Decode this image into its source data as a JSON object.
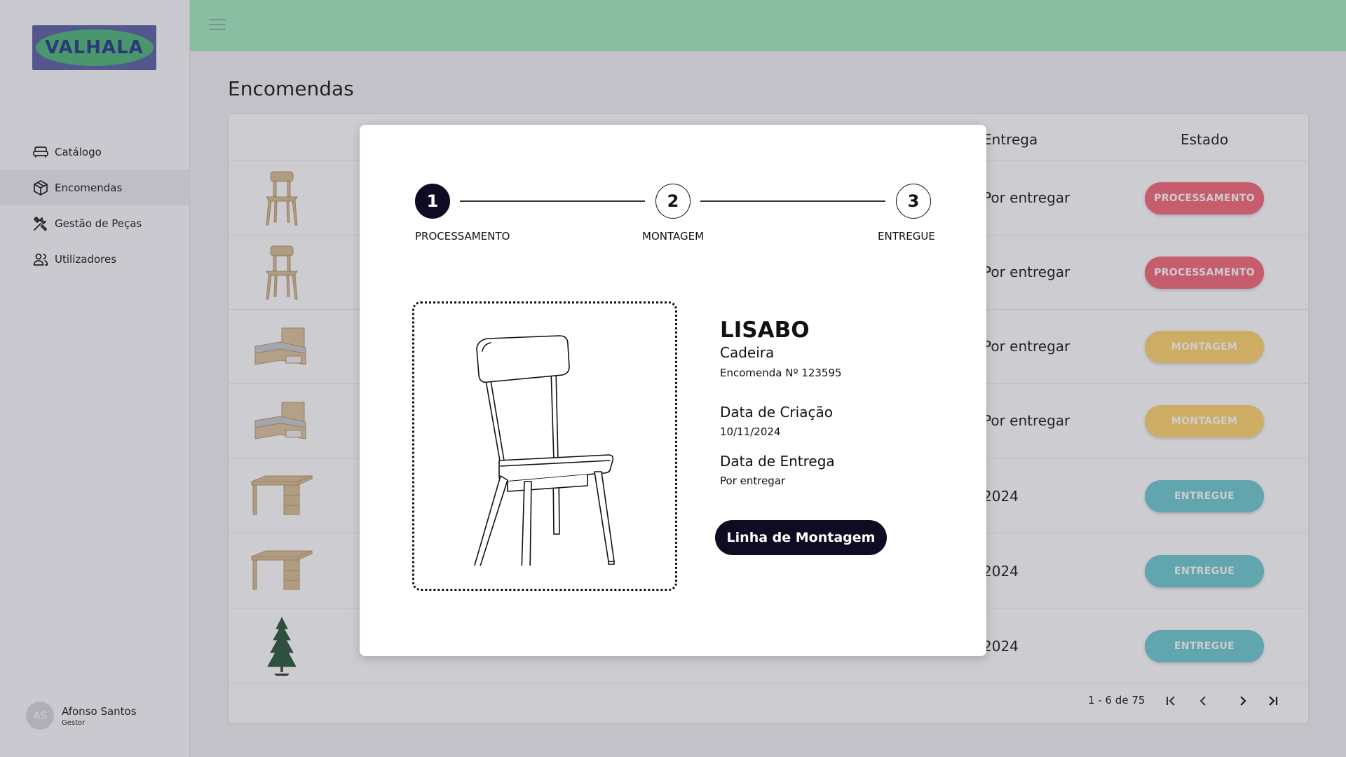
{
  "brand": {
    "logo_text": "VALHALA"
  },
  "sidebar": {
    "items": [
      {
        "label": "Catálogo",
        "icon": "sofa-icon"
      },
      {
        "label": "Encomendas",
        "icon": "package-icon",
        "active": true
      },
      {
        "label": "Gestão de Peças",
        "icon": "tools-icon"
      },
      {
        "label": "Utilizadores",
        "icon": "users-icon"
      }
    ],
    "user": {
      "initials": "AS",
      "name": "Afonso Santos",
      "role": "Gestor"
    }
  },
  "page": {
    "title": "Encomendas"
  },
  "table": {
    "columns": {
      "entrega": "Entrega",
      "estado": "Estado"
    },
    "rows": [
      {
        "thumb": "chair",
        "entrega": "Por entregar",
        "estado": "PROCESSAMENTO"
      },
      {
        "thumb": "chair",
        "entrega": "Por entregar",
        "estado": "PROCESSAMENTO"
      },
      {
        "thumb": "bed",
        "entrega": "Por entregar",
        "estado": "MONTAGEM"
      },
      {
        "thumb": "bed",
        "entrega": "Por entregar",
        "estado": "MONTAGEM"
      },
      {
        "thumb": "desk",
        "entrega": "2024",
        "estado": "ENTREGUE"
      },
      {
        "thumb": "desk",
        "entrega": "2024",
        "estado": "ENTREGUE"
      },
      {
        "thumb": "tree",
        "entrega": "2024",
        "estado": "ENTREGUE"
      }
    ],
    "pagination": {
      "range": "1 - 6 de 75"
    }
  },
  "modal": {
    "steps": [
      {
        "number": "1",
        "label": "PROCESSAMENTO",
        "active": true
      },
      {
        "number": "2",
        "label": "MONTAGEM",
        "active": false
      },
      {
        "number": "3",
        "label": "ENTREGUE",
        "active": false
      }
    ],
    "product": {
      "name": "LISABO",
      "type": "Cadeira",
      "order": "Encomenda Nº 123595",
      "created_label": "Data de Criação",
      "created_value": "10/11/2024",
      "delivery_label": "Data de Entrega",
      "delivery_value": "Por entregar"
    },
    "button": "Linha de Montagem"
  },
  "colors": {
    "topbar": "#a6edc1",
    "processamento": "#f56b78",
    "montagem": "#ffd66e",
    "entregue": "#6fcbd1",
    "dark": "#0e0b22"
  }
}
